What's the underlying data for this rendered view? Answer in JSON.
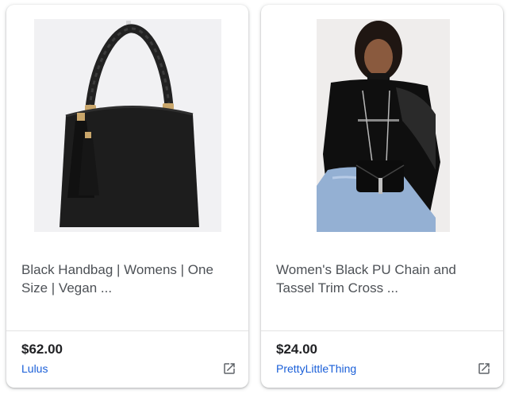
{
  "products": [
    {
      "title": "Black Handbag | Womens | One Size | Vegan ...",
      "price": "$62.00",
      "store": "Lulus",
      "image_alt": "Black handbag with braided handles and tassel"
    },
    {
      "title": "Women's Black PU Chain and Tassel Trim Cross ...",
      "price": "$24.00",
      "store": "PrettyLittleThing",
      "image_alt": "Model wearing black top with black crossbody bag"
    }
  ],
  "colors": {
    "title_text": "#4d5156",
    "price_text": "#202124",
    "store_link": "#1a5fd8",
    "icon_gray": "#5f6368"
  },
  "icons": {
    "external_link": "open-in-new-icon"
  }
}
